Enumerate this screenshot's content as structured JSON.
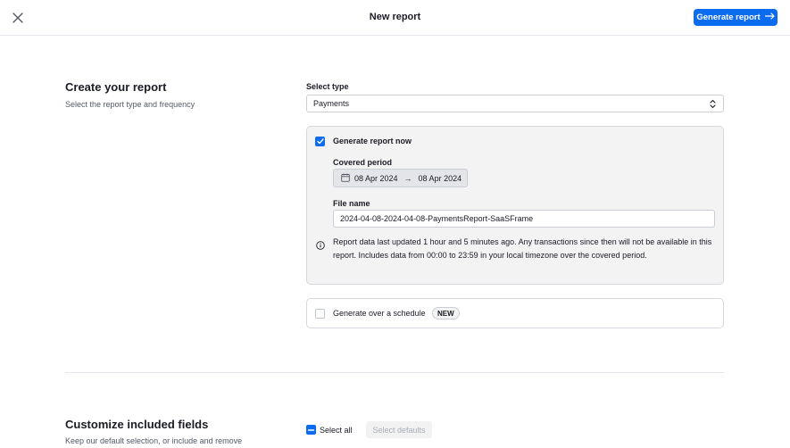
{
  "header": {
    "title": "New report",
    "close_icon": "close-icon",
    "primary_button": {
      "label": "Generate report",
      "icon": "arrow-right-icon"
    },
    "accent_color": "#0c6cf0"
  },
  "create_section": {
    "title": "Create your report",
    "subtitle": "Select the report type and frequency",
    "select_type": {
      "label": "Select type",
      "value": "Payments",
      "icon": "chevron-updown-icon"
    },
    "generate_now": {
      "checked": true,
      "label": "Generate report now",
      "covered_period": {
        "label": "Covered period",
        "icon": "calendar-icon",
        "start": "08 Apr 2024",
        "arrow": "→",
        "end": "08 Apr 2024"
      },
      "file_name": {
        "label": "File name",
        "value": "2024-04-08-2024-04-08-PaymentsReport-SaaSFrame"
      },
      "info": {
        "icon": "info-icon",
        "text": "Report data last updated 1 hour and 5 minutes ago. Any transactions since then will not be available in this report. Includes data from 00:00 to 23:59 in your local timezone over the covered period."
      }
    },
    "schedule": {
      "checked": false,
      "label": "Generate over a schedule",
      "badge": "NEW"
    }
  },
  "fields_section": {
    "title": "Customize included fields",
    "subtitle": "Keep our default selection, or include and remove",
    "select_all_label": "Select all",
    "select_defaults_label": "Select defaults"
  }
}
